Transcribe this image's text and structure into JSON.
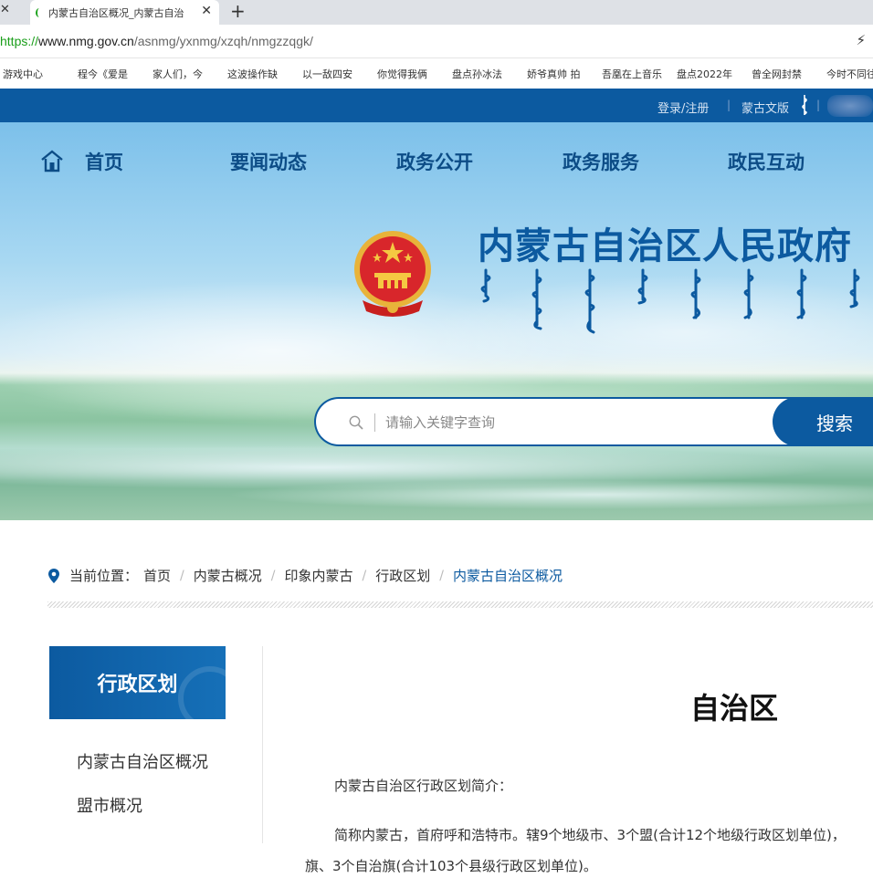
{
  "browser": {
    "tab_title": "内蒙古自治区概况_内蒙古自治",
    "url_scheme": "https://",
    "url_host": "www.nmg.gov.cn",
    "url_path": "/asnmg/yxnmg/xzqh/nmgzzqgk/",
    "bookmarks": [
      "游戏中心",
      "程今《爱是",
      "家人们，今",
      "这波操作缺",
      "以一敌四安",
      "你觉得我俩",
      "盘点孙冰法",
      "娇爷真帅 拍",
      "吾凰在上音乐",
      "盘点2022年",
      "曾全网封禁",
      "今时不同往日"
    ]
  },
  "top_strip": {
    "login": "登录/注册",
    "mongol_version": "蒙古文版"
  },
  "nav": {
    "items": [
      "首页",
      "要闻动态",
      "政务公开",
      "政务服务",
      "政民互动"
    ]
  },
  "banner": {
    "title": "内蒙古自治区人民政府"
  },
  "search": {
    "placeholder": "请输入关键字查询",
    "button": "搜索"
  },
  "breadcrumb": {
    "label": "当前位置：",
    "items": [
      "首页",
      "内蒙古概况",
      "印象内蒙古",
      "行政区划"
    ],
    "current": "内蒙古自治区概况"
  },
  "sidebar": {
    "title": "行政区划",
    "items": [
      "内蒙古自治区概况",
      "盟市概况"
    ]
  },
  "article": {
    "title": "自治区",
    "intro": "内蒙古自治区行政区划简介：",
    "para1": "简称内蒙古，首府呼和浩特市。辖9个地级市、3个盟(合计12个地级行政区划单位)，",
    "para2": "旗、3个自治旗(合计103个县级行政区划单位)。"
  },
  "colors": {
    "brand_blue": "#0c5aa0",
    "nav_text": "#0c4c86"
  }
}
